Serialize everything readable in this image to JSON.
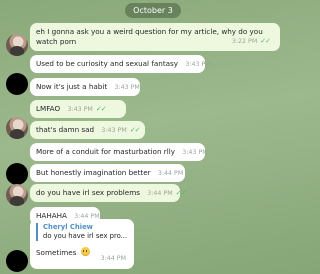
{
  "date_label": "October 3",
  "messages": [
    {
      "text": "eh I gonna ask you a weird question for my article, why do you watch porn",
      "time": "3:22 PM",
      "ticks": "✓✓"
    },
    {
      "text": "Used to be curiosity and sexual fantasy",
      "time": "3:43 PM"
    },
    {
      "text": "Now it's just a habit",
      "time": "3:43 PM"
    },
    {
      "text": "LMFAO",
      "time": "3:43 PM",
      "ticks": "✓✓"
    },
    {
      "text": "that's damn sad",
      "time": "3:43 PM",
      "ticks": "✓✓"
    },
    {
      "text": "More of a conduit for masturbation rlly",
      "time": "3:43 PM"
    },
    {
      "text": "But honestly imagination better",
      "time": "3:44 PM"
    },
    {
      "text": "do you have irl sex problems",
      "time": "3:44 PM",
      "ticks": "✓✓"
    },
    {
      "text": "HAHAHA",
      "time": "3:44 PM"
    }
  ],
  "reply": {
    "quoted_name": "Cheryl Chiew",
    "quoted_text": "do you have irl sex pro...",
    "text": "Sometimes",
    "time": "3:44 PM"
  }
}
